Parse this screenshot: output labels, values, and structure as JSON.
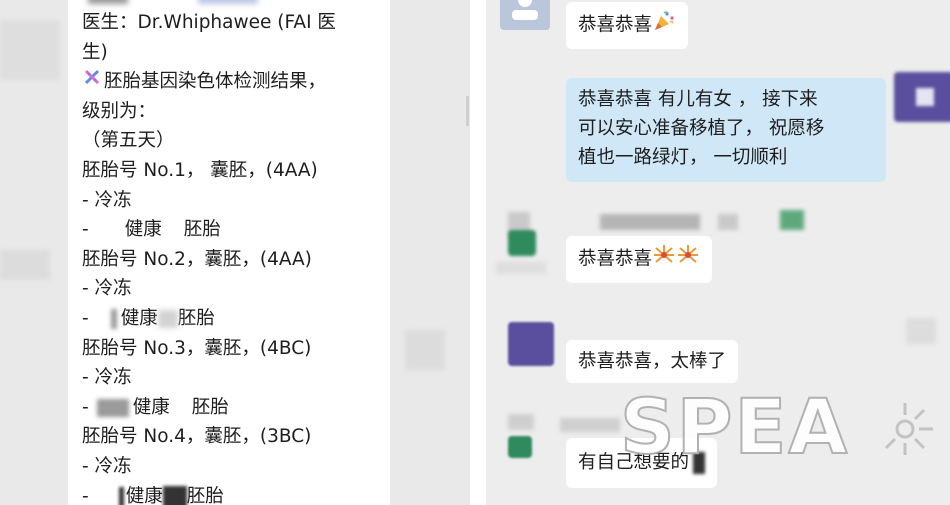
{
  "left": {
    "lines": [
      "医生：Dr.Whiphawee (FAI 医",
      "生)",
      "胚胎基因染色体检测结果，",
      "级别为：",
      "（第五天）",
      "胚胎号 No.1，  囊胚，(4AA)",
      "- 冷冻",
      "-",
      "健康",
      "胚胎",
      "胚胎号 No.2，囊胚，(4AA)",
      "- 冷冻",
      "-",
      "健康",
      "胚胎",
      "胚胎号 No.3，囊胚，(4BC)",
      "- 冷冻",
      "-",
      "健康",
      "胚胎",
      "胚胎号 No.4，囊胚，(3BC)",
      "- 冷冻",
      "-",
      "健康",
      "胚胎"
    ]
  },
  "chat": {
    "messages": [
      {
        "text": "恭喜恭喜",
        "emoji": "party-popper-icon"
      },
      {
        "text": "恭喜恭喜  有儿有女 ，  接下来可以安心准备移植了，  祝愿移植也一路绿灯，  一切顺利",
        "line1": "恭喜恭喜  有儿有女 ，  接下来",
        "line2": "可以安心准备移植了，  祝愿移",
        "line3": "植也一路绿灯，  一切顺利"
      },
      {
        "text": "恭喜恭喜",
        "emoji": "fireworks-icon"
      },
      {
        "text": "恭喜恭喜，太棒了"
      },
      {
        "text": "有自己想要的"
      }
    ]
  },
  "watermark": {
    "text": "SPEA"
  },
  "colors": {
    "mine_bubble": "#cfe7f7",
    "other_bubble": "#ffffff",
    "avatar_purple": "#5a4f9e",
    "avatar_green": "#2f8a5e"
  }
}
